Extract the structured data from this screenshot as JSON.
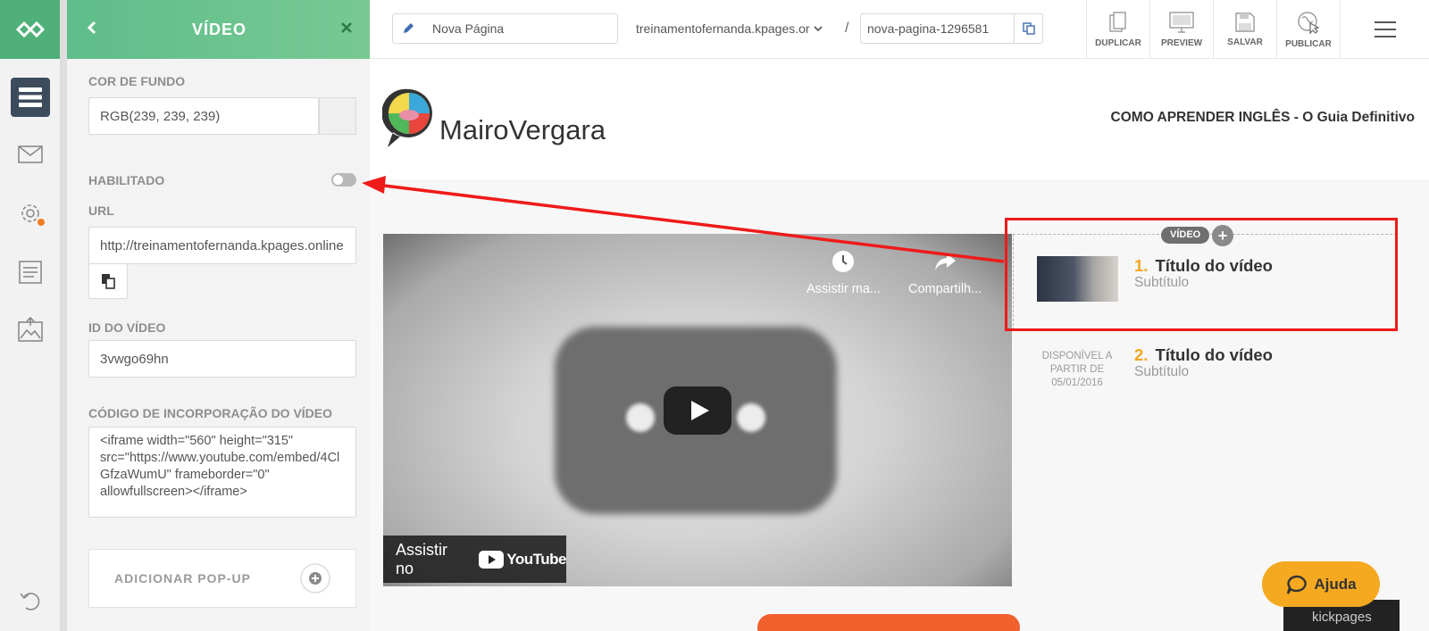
{
  "panel": {
    "title": "VÍDEO",
    "cor_label": "COR DE FUNDO",
    "cor_value": "RGB(239, 239, 239)",
    "habilitado_label": "HABILITADO",
    "url_label": "URL",
    "url_value": "http://treinamentofernanda.kpages.online",
    "id_label": "ID DO VÍDEO",
    "id_value": "3vwgo69hn",
    "embed_label": "CÓDIGO DE INCORPORAÇÃO DO VÍDEO",
    "embed_value": "<iframe width=\"560\" height=\"315\" src=\"https://www.youtube.com/embed/4ClGfzaWumU\" frameborder=\"0\" allowfullscreen></iframe>",
    "popup_label": "ADICIONAR POP-UP",
    "habilitado_on": false
  },
  "topbar": {
    "page_name": "Nova Página",
    "domain": "treinamentofernanda.kpages.or",
    "separator": "/",
    "slug": "nova-pagina-1296581",
    "buttons": [
      "DUPLICAR",
      "PREVIEW",
      "SALVAR",
      "PUBLICAR"
    ]
  },
  "site": {
    "brand": "MairoVergara",
    "title": "COMO APRENDER INGLÊS - O Guia Definitivo"
  },
  "video": {
    "watch_later": "Assistir ma...",
    "share": "Compartilh...",
    "watch_on": "Assistir no",
    "youtube": "YouTube"
  },
  "playlist": {
    "tag": "VÍDEO",
    "items": [
      {
        "num": "1.",
        "title": "Título do vídeo",
        "subtitle": "Subtítulo"
      },
      {
        "num": "2.",
        "title": "Título do vídeo",
        "subtitle": "Subtítulo",
        "available": "DISPONÍVEL A PARTIR DE 05/01/2016"
      }
    ]
  },
  "help": {
    "label": "Ajuda"
  },
  "footer_brand": "kickpages",
  "colors": {
    "green": "#5ebd8a",
    "accent": "#f5a623",
    "highlight": "#ef1a1a",
    "rail_active": "#3d4c5c"
  }
}
